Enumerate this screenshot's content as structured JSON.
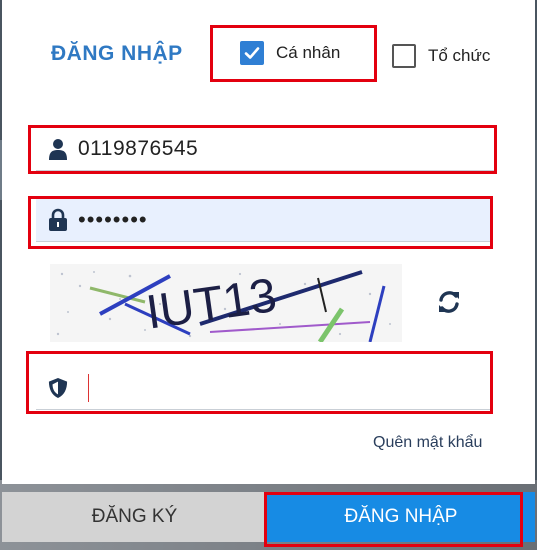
{
  "login": {
    "title": "ĐĂNG NHẬP",
    "account_types": [
      {
        "label": "Cá nhân",
        "checked": true
      },
      {
        "label": "Tổ chức",
        "checked": false
      }
    ],
    "username_value": "0119876545",
    "password_masked": "••••••••",
    "captcha_value": "",
    "captcha_text": "IUT13",
    "forgot_password": "Quên mật khẩu",
    "register_button": "ĐĂNG KÝ",
    "login_button": "ĐĂNG NHẬP"
  },
  "colors": {
    "accent": "#2f79c3",
    "primary_button": "#178be4",
    "secondary_button": "#d3d3d3",
    "highlight": "#e3000f"
  }
}
